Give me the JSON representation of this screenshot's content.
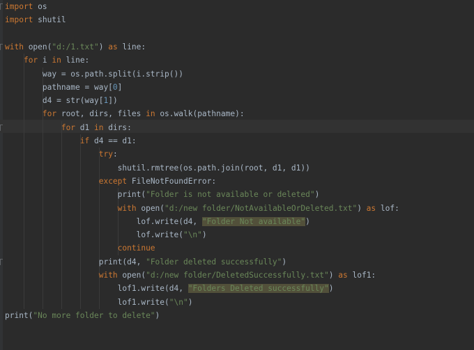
{
  "colors": {
    "background": "#2b2b2b",
    "keyword": "#cc7832",
    "string": "#6a8759",
    "number": "#6897bb",
    "default": "#a9b7c6",
    "highlight": "#52503a"
  },
  "lines": [
    [
      {
        "t": "import",
        "c": "kw"
      },
      {
        "t": " os",
        "c": "pl"
      }
    ],
    [
      {
        "t": "import",
        "c": "kw"
      },
      {
        "t": " shutil",
        "c": "pl"
      }
    ],
    [],
    [
      {
        "t": "with",
        "c": "kw"
      },
      {
        "t": " open(",
        "c": "pl"
      },
      {
        "t": "\"d:/1.txt\"",
        "c": "str"
      },
      {
        "t": ") ",
        "c": "pl"
      },
      {
        "t": "as",
        "c": "kw"
      },
      {
        "t": " line:",
        "c": "pl"
      }
    ],
    [
      {
        "t": "    ",
        "c": "pl"
      },
      {
        "t": "for",
        "c": "kw"
      },
      {
        "t": " i ",
        "c": "pl"
      },
      {
        "t": "in",
        "c": "kw"
      },
      {
        "t": " line:",
        "c": "pl"
      }
    ],
    [
      {
        "t": "        way = os.path.split(i.strip())",
        "c": "pl"
      }
    ],
    [
      {
        "t": "        pathname = way[",
        "c": "pl"
      },
      {
        "t": "0",
        "c": "num"
      },
      {
        "t": "]",
        "c": "pl"
      }
    ],
    [
      {
        "t": "        d4 = str(way[",
        "c": "pl"
      },
      {
        "t": "1",
        "c": "num"
      },
      {
        "t": "])",
        "c": "pl"
      }
    ],
    [
      {
        "t": "        ",
        "c": "pl"
      },
      {
        "t": "for",
        "c": "kw"
      },
      {
        "t": " root, dirs, files ",
        "c": "pl"
      },
      {
        "t": "in",
        "c": "kw"
      },
      {
        "t": " os.walk(pathname):",
        "c": "pl"
      }
    ],
    [
      {
        "t": "            ",
        "c": "pl"
      },
      {
        "t": "for",
        "c": "kw"
      },
      {
        "t": " d1 ",
        "c": "pl"
      },
      {
        "t": "in",
        "c": "kw"
      },
      {
        "t": " dirs:",
        "c": "pl"
      }
    ],
    [
      {
        "t": "                ",
        "c": "pl"
      },
      {
        "t": "if",
        "c": "kw"
      },
      {
        "t": " d4 == d1:",
        "c": "pl"
      }
    ],
    [
      {
        "t": "                    ",
        "c": "pl"
      },
      {
        "t": "try",
        "c": "kw"
      },
      {
        "t": ":",
        "c": "pl"
      }
    ],
    [
      {
        "t": "                        shutil.rmtree(os.path.join(root, d1, d1))",
        "c": "pl"
      }
    ],
    [
      {
        "t": "                    ",
        "c": "pl"
      },
      {
        "t": "except",
        "c": "kw"
      },
      {
        "t": " FileNotFoundError:",
        "c": "pl"
      }
    ],
    [
      {
        "t": "                        print(",
        "c": "pl"
      },
      {
        "t": "\"Folder is not available or deleted\"",
        "c": "str"
      },
      {
        "t": ")",
        "c": "pl"
      }
    ],
    [
      {
        "t": "                        ",
        "c": "pl"
      },
      {
        "t": "with",
        "c": "kw"
      },
      {
        "t": " open(",
        "c": "pl"
      },
      {
        "t": "\"d:/new folder/NotAvailableOrDeleted.txt\"",
        "c": "str"
      },
      {
        "t": ") ",
        "c": "pl"
      },
      {
        "t": "as",
        "c": "kw"
      },
      {
        "t": " lof:",
        "c": "pl"
      }
    ],
    [
      {
        "t": "                            lof.write(d4, ",
        "c": "pl"
      },
      {
        "t": "\"Folder Not available\"",
        "c": "str hl"
      },
      {
        "t": ")",
        "c": "pl"
      }
    ],
    [
      {
        "t": "                            lof.write(",
        "c": "pl"
      },
      {
        "t": "\"\\n\"",
        "c": "str"
      },
      {
        "t": ")",
        "c": "pl"
      }
    ],
    [
      {
        "t": "                        ",
        "c": "pl"
      },
      {
        "t": "continue",
        "c": "kw"
      }
    ],
    [
      {
        "t": "                    print(d4, ",
        "c": "pl"
      },
      {
        "t": "\"Folder deleted successfully\"",
        "c": "str"
      },
      {
        "t": ")",
        "c": "pl"
      }
    ],
    [
      {
        "t": "                    ",
        "c": "pl"
      },
      {
        "t": "with",
        "c": "kw"
      },
      {
        "t": " open(",
        "c": "pl"
      },
      {
        "t": "\"d:/new folder/DeletedSuccessfully.txt\"",
        "c": "str"
      },
      {
        "t": ") ",
        "c": "pl"
      },
      {
        "t": "as",
        "c": "kw"
      },
      {
        "t": " lof1:",
        "c": "pl"
      }
    ],
    [
      {
        "t": "                        lof1.write(d4, ",
        "c": "pl"
      },
      {
        "t": "\"Folders Deleted successfully\"",
        "c": "str hl"
      },
      {
        "t": ")",
        "c": "pl"
      }
    ],
    [
      {
        "t": "                        lof1.write(",
        "c": "pl"
      },
      {
        "t": "\"\\n\"",
        "c": "str"
      },
      {
        "t": ")",
        "c": "pl"
      }
    ],
    [
      {
        "t": "print(",
        "c": "pl"
      },
      {
        "t": "\"No more folder to delete\"",
        "c": "str"
      },
      {
        "t": ")",
        "c": "pl"
      }
    ]
  ]
}
